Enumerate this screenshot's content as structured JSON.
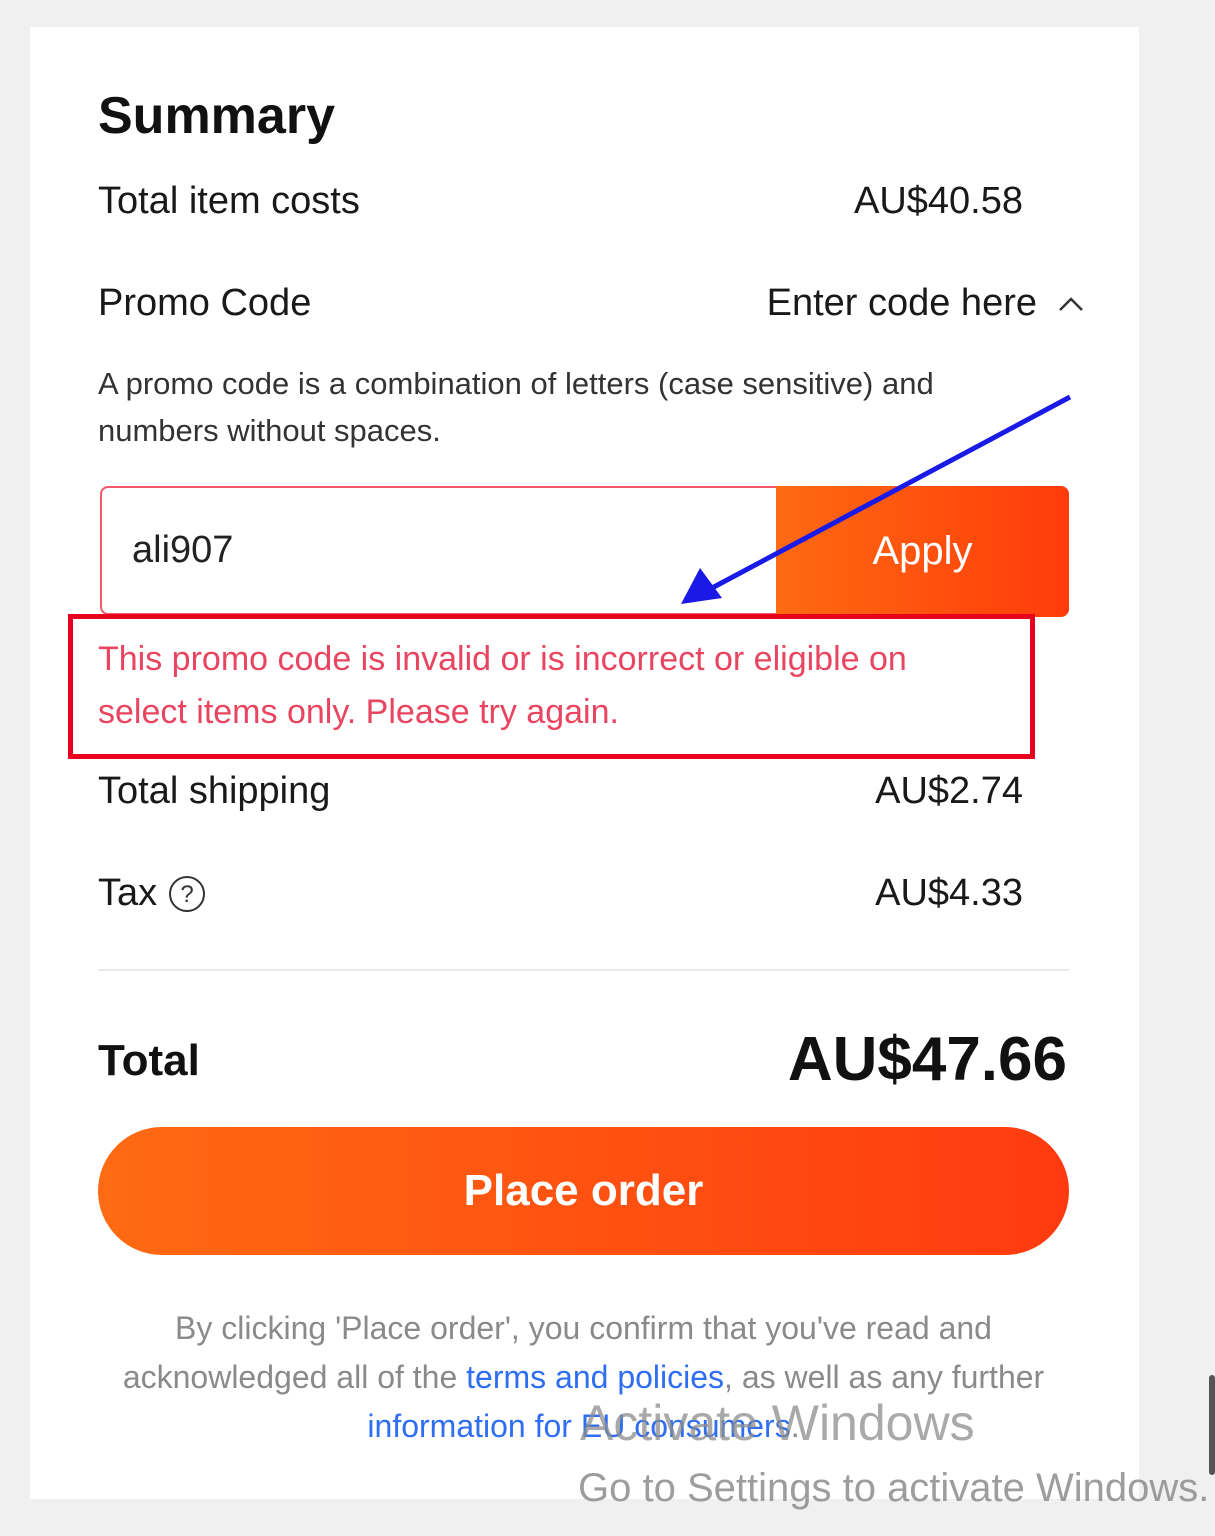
{
  "summary": {
    "title": "Summary",
    "item_costs_label": "Total item costs",
    "item_costs_value": "AU$40.58",
    "promo_label": "Promo Code",
    "promo_toggle": "Enter code here",
    "promo_hint": "A promo code is a combination of letters (case sensitive) and numbers without spaces.",
    "promo_value": "ali907",
    "apply_label": "Apply",
    "error_message": "This promo code is invalid or is incorrect or eligible on select items only. Please try again.",
    "shipping_label": "Total shipping",
    "shipping_value": "AU$2.74",
    "tax_label": "Tax",
    "tax_value": "AU$4.33",
    "total_label": "Total",
    "total_value": "AU$47.66",
    "place_order_label": "Place order"
  },
  "legal": {
    "part1": "By clicking 'Place order', you confirm that you've read and acknowledged all of the ",
    "terms_link": "terms and policies",
    "part2": ", as well as any further ",
    "eu_link": "information for EU consumers",
    "part3": "."
  },
  "watermark": {
    "line1": "Activate Windows",
    "line2": "Go to Settings to activate Windows."
  },
  "icons": {
    "toggle": "chevron-up-icon",
    "tax_help": "question-circle-icon"
  },
  "colors": {
    "accent": "#ff4d0e",
    "error": "#e94560",
    "highlight_box": "#e8001e",
    "annotation_arrow": "#1a1ae6",
    "link": "#2f6ef2"
  }
}
